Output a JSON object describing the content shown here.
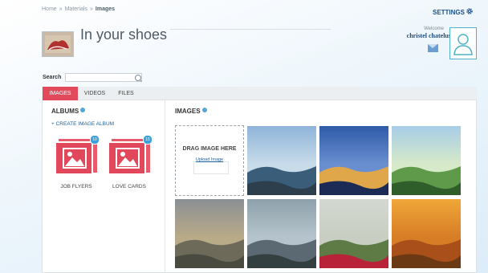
{
  "breadcrumb": {
    "home": "Home",
    "sep": "»",
    "materials": "Materials",
    "current": "Images"
  },
  "header": {
    "title": "In your shoes",
    "settings_label": "SETTINGS",
    "welcome_label": "Welcome",
    "username": "christel chatelus"
  },
  "search": {
    "label": "Search",
    "value": ""
  },
  "tabs": [
    {
      "label": "IMAGES",
      "active": true
    },
    {
      "label": "VIDEOS",
      "active": false
    },
    {
      "label": "FILES",
      "active": false
    }
  ],
  "albums": {
    "title": "ALBUMS",
    "create_label": "+ CREATE IMAGE ALBUM",
    "items": [
      {
        "label": "JOB FLYERS",
        "count": "10"
      },
      {
        "label": "LOVE CARDS",
        "count": "15"
      }
    ]
  },
  "images": {
    "title": "IMAGES",
    "dropzone_text": "DRAG IMAGE HERE",
    "upload_label": "Upload Image",
    "thumbs": [
      {
        "caption": "",
        "colors": [
          "#8fb4d9",
          "#c7dbe9",
          "#3a5e7a",
          "#2d3f4d"
        ]
      },
      {
        "caption": "",
        "colors": [
          "#2e5aa8",
          "#6a8fd0",
          "#e0a64a",
          "#1b2b55"
        ]
      },
      {
        "caption": "",
        "colors": [
          "#a7cde8",
          "#d6e9c8",
          "#5f9a4a",
          "#2f5e2a"
        ]
      },
      {
        "caption": "",
        "colors": [
          "#8a8f94",
          "#b9aa88",
          "#6e6a5a",
          "#4a4a40"
        ]
      },
      {
        "caption": "",
        "colors": [
          "#8ea1ab",
          "#b5c4cc",
          "#5b6a72",
          "#34403f"
        ]
      },
      {
        "caption": "",
        "colors": [
          "#d4d8d2",
          "#c8cec2",
          "#5e7b45",
          "#b8233a"
        ]
      },
      {
        "caption": "",
        "colors": [
          "#f0a738",
          "#d77d26",
          "#a84f1a",
          "#6b3a14"
        ]
      }
    ]
  }
}
